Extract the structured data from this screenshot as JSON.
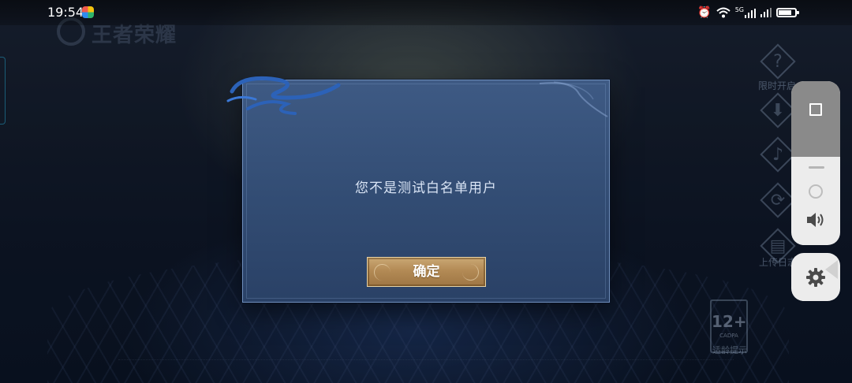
{
  "status_bar": {
    "time": "19:54",
    "app_icon": "colorful-app-icon",
    "icons": [
      "alarm-icon",
      "wifi-icon",
      "signal-5g-icon",
      "signal-icon",
      "battery-icon"
    ],
    "network_label": "5G",
    "battery_level": 0.8
  },
  "background": {
    "logo_text": "王者荣耀",
    "side_labels": [
      "限时开启",
      "上传日志"
    ],
    "age_rating": "12+",
    "age_rating_org": "CADPA",
    "age_caption": "适龄提示"
  },
  "dialog": {
    "message": "您不是测试白名单用户",
    "confirm_label": "确定"
  },
  "floating_panel": {
    "buttons": [
      "square-icon",
      "circle-icon",
      "volume-icon",
      "gear-icon",
      "back-icon"
    ]
  },
  "colors": {
    "dialog_bg": "#324c73",
    "dialog_border": "#6f8fbd",
    "button_gold": "#b38a55",
    "message_text": "#d9e4f5"
  }
}
